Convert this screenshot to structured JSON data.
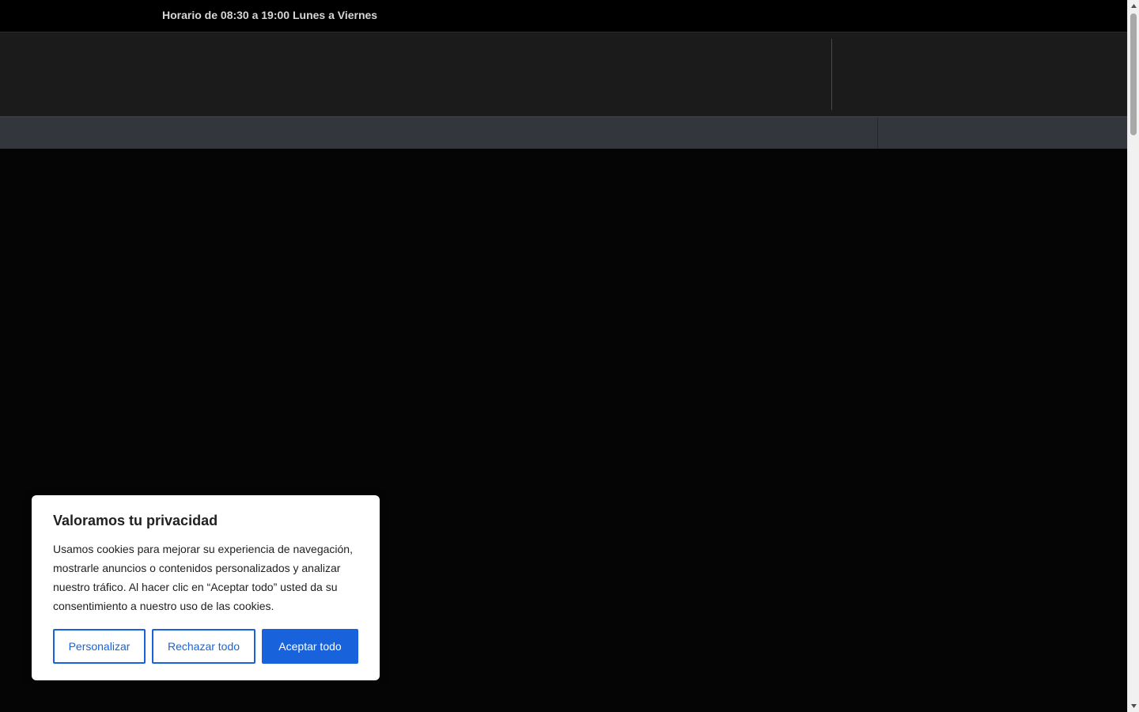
{
  "topbar": {
    "hours": "Horario de 08:30 a 19:00 Lunes a Viernes"
  },
  "cookie_banner": {
    "title": "Valoramos tu privacidad",
    "description": "Usamos cookies para mejorar su experiencia de navegación, mostrarle anuncios o contenidos personalizados y analizar nuestro tráfico. Al hacer clic en “Aceptar todo” usted da su consentimiento a nuestro uso de las cookies.",
    "customize_label": "Personalizar",
    "reject_label": "Rechazar todo",
    "accept_label": "Aceptar todo"
  },
  "colors": {
    "accent": "#1863dc",
    "topbar_bg": "#000000",
    "header_bg": "#1b1b1c",
    "nav_bg": "#33373d"
  },
  "icons": {
    "scroll_up": "triangle-up-icon",
    "scroll_down": "triangle-down-icon"
  }
}
